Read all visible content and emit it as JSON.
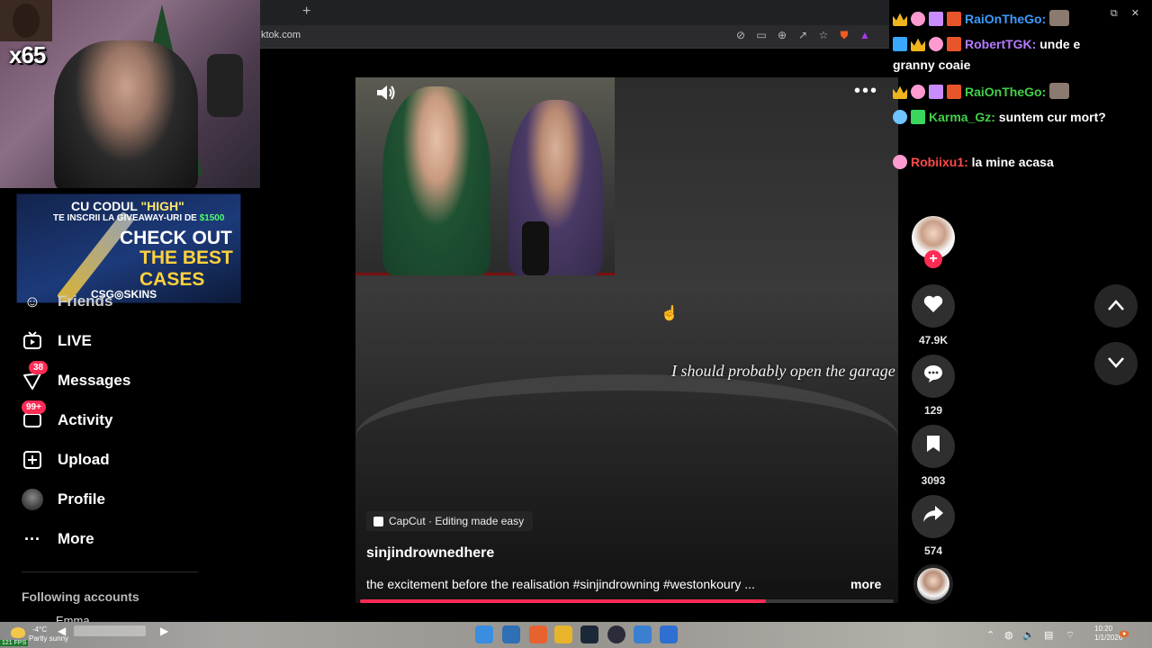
{
  "browser": {
    "url": "ktok.com",
    "new_tab_label": "+"
  },
  "stream_overlay": {
    "combo_multiplier": "x65"
  },
  "ad": {
    "line1_prefix": "CU CODUL ",
    "line1_code": "\"HIGH\"",
    "line2_prefix": "TE INSCRII LA GIVEAWAY-URI DE ",
    "line2_amount": "$1500",
    "cta_line1": "CHECK OUT",
    "cta_line2": "THE BEST CASES",
    "brand": "CSG◎SKINS"
  },
  "sidebar": {
    "cut_item": "Friends",
    "items": [
      {
        "label": "LIVE",
        "icon": "live-tv-icon"
      },
      {
        "label": "Messages",
        "icon": "messages-icon",
        "badge": "38"
      },
      {
        "label": "Activity",
        "icon": "activity-icon",
        "badge": "99+"
      },
      {
        "label": "Upload",
        "icon": "upload-icon"
      },
      {
        "label": "Profile",
        "icon": "avatar"
      },
      {
        "label": "More",
        "icon": "more-dots-icon"
      }
    ],
    "following_title": "Following accounts",
    "following_first": "Emma"
  },
  "video": {
    "subtitle": "I should probably open the garage do",
    "effect_label": "CapCut · Editing made easy",
    "author": "sinjindrownedhere",
    "caption": "the excitement before the realisation #sinjindrowning #westonkoury ...",
    "more_label": "more",
    "progress": 0.76
  },
  "actions": {
    "likes": "47.9K",
    "comments": "129",
    "saves": "3093",
    "shares": "574"
  },
  "chat": {
    "messages": [
      {
        "user": "RaiOnTheGo:",
        "text": "",
        "user_class": "user1"
      },
      {
        "user": "RobertTGK:",
        "text": " unde e granny coaie",
        "user_class": "user2"
      },
      {
        "user": "RaiOnTheGo:",
        "text": "",
        "user_class": "user3"
      },
      {
        "user": "Karma_Gz:",
        "text": " suntem cur mort?",
        "user_class": "user3"
      },
      {
        "user": "Robiixu1:",
        "text": " la mine acasa",
        "user_class": "user4"
      }
    ]
  },
  "taskbar": {
    "fps": "121 FPS",
    "temperature": "-4°C",
    "weather": "Partly sunny",
    "time": "10:20",
    "date": "1/1/2026"
  },
  "colors": {
    "accent": "#fe2c55",
    "background": "#000000"
  }
}
